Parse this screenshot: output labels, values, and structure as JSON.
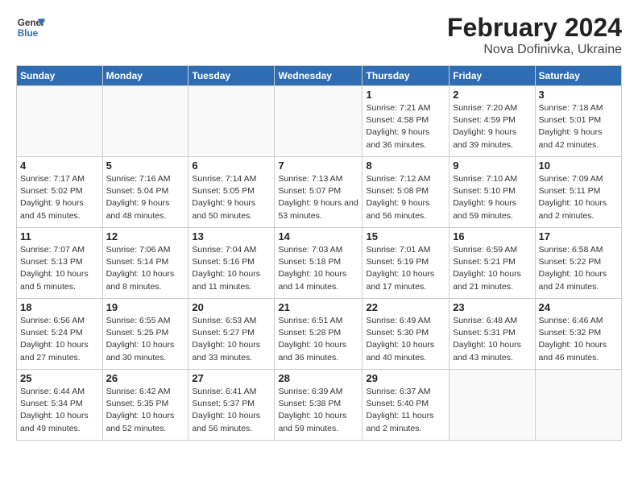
{
  "header": {
    "logo_line1": "General",
    "logo_line2": "Blue",
    "main_title": "February 2024",
    "subtitle": "Nova Dofinivka, Ukraine"
  },
  "calendar": {
    "days_of_week": [
      "Sunday",
      "Monday",
      "Tuesday",
      "Wednesday",
      "Thursday",
      "Friday",
      "Saturday"
    ],
    "weeks": [
      [
        {
          "day": "",
          "info": ""
        },
        {
          "day": "",
          "info": ""
        },
        {
          "day": "",
          "info": ""
        },
        {
          "day": "",
          "info": ""
        },
        {
          "day": "1",
          "info": "Sunrise: 7:21 AM\nSunset: 4:58 PM\nDaylight: 9 hours and 36 minutes."
        },
        {
          "day": "2",
          "info": "Sunrise: 7:20 AM\nSunset: 4:59 PM\nDaylight: 9 hours and 39 minutes."
        },
        {
          "day": "3",
          "info": "Sunrise: 7:18 AM\nSunset: 5:01 PM\nDaylight: 9 hours and 42 minutes."
        }
      ],
      [
        {
          "day": "4",
          "info": "Sunrise: 7:17 AM\nSunset: 5:02 PM\nDaylight: 9 hours and 45 minutes."
        },
        {
          "day": "5",
          "info": "Sunrise: 7:16 AM\nSunset: 5:04 PM\nDaylight: 9 hours and 48 minutes."
        },
        {
          "day": "6",
          "info": "Sunrise: 7:14 AM\nSunset: 5:05 PM\nDaylight: 9 hours and 50 minutes."
        },
        {
          "day": "7",
          "info": "Sunrise: 7:13 AM\nSunset: 5:07 PM\nDaylight: 9 hours and 53 minutes."
        },
        {
          "day": "8",
          "info": "Sunrise: 7:12 AM\nSunset: 5:08 PM\nDaylight: 9 hours and 56 minutes."
        },
        {
          "day": "9",
          "info": "Sunrise: 7:10 AM\nSunset: 5:10 PM\nDaylight: 9 hours and 59 minutes."
        },
        {
          "day": "10",
          "info": "Sunrise: 7:09 AM\nSunset: 5:11 PM\nDaylight: 10 hours and 2 minutes."
        }
      ],
      [
        {
          "day": "11",
          "info": "Sunrise: 7:07 AM\nSunset: 5:13 PM\nDaylight: 10 hours and 5 minutes."
        },
        {
          "day": "12",
          "info": "Sunrise: 7:06 AM\nSunset: 5:14 PM\nDaylight: 10 hours and 8 minutes."
        },
        {
          "day": "13",
          "info": "Sunrise: 7:04 AM\nSunset: 5:16 PM\nDaylight: 10 hours and 11 minutes."
        },
        {
          "day": "14",
          "info": "Sunrise: 7:03 AM\nSunset: 5:18 PM\nDaylight: 10 hours and 14 minutes."
        },
        {
          "day": "15",
          "info": "Sunrise: 7:01 AM\nSunset: 5:19 PM\nDaylight: 10 hours and 17 minutes."
        },
        {
          "day": "16",
          "info": "Sunrise: 6:59 AM\nSunset: 5:21 PM\nDaylight: 10 hours and 21 minutes."
        },
        {
          "day": "17",
          "info": "Sunrise: 6:58 AM\nSunset: 5:22 PM\nDaylight: 10 hours and 24 minutes."
        }
      ],
      [
        {
          "day": "18",
          "info": "Sunrise: 6:56 AM\nSunset: 5:24 PM\nDaylight: 10 hours and 27 minutes."
        },
        {
          "day": "19",
          "info": "Sunrise: 6:55 AM\nSunset: 5:25 PM\nDaylight: 10 hours and 30 minutes."
        },
        {
          "day": "20",
          "info": "Sunrise: 6:53 AM\nSunset: 5:27 PM\nDaylight: 10 hours and 33 minutes."
        },
        {
          "day": "21",
          "info": "Sunrise: 6:51 AM\nSunset: 5:28 PM\nDaylight: 10 hours and 36 minutes."
        },
        {
          "day": "22",
          "info": "Sunrise: 6:49 AM\nSunset: 5:30 PM\nDaylight: 10 hours and 40 minutes."
        },
        {
          "day": "23",
          "info": "Sunrise: 6:48 AM\nSunset: 5:31 PM\nDaylight: 10 hours and 43 minutes."
        },
        {
          "day": "24",
          "info": "Sunrise: 6:46 AM\nSunset: 5:32 PM\nDaylight: 10 hours and 46 minutes."
        }
      ],
      [
        {
          "day": "25",
          "info": "Sunrise: 6:44 AM\nSunset: 5:34 PM\nDaylight: 10 hours and 49 minutes."
        },
        {
          "day": "26",
          "info": "Sunrise: 6:42 AM\nSunset: 5:35 PM\nDaylight: 10 hours and 52 minutes."
        },
        {
          "day": "27",
          "info": "Sunrise: 6:41 AM\nSunset: 5:37 PM\nDaylight: 10 hours and 56 minutes."
        },
        {
          "day": "28",
          "info": "Sunrise: 6:39 AM\nSunset: 5:38 PM\nDaylight: 10 hours and 59 minutes."
        },
        {
          "day": "29",
          "info": "Sunrise: 6:37 AM\nSunset: 5:40 PM\nDaylight: 11 hours and 2 minutes."
        },
        {
          "day": "",
          "info": ""
        },
        {
          "day": "",
          "info": ""
        }
      ]
    ]
  }
}
